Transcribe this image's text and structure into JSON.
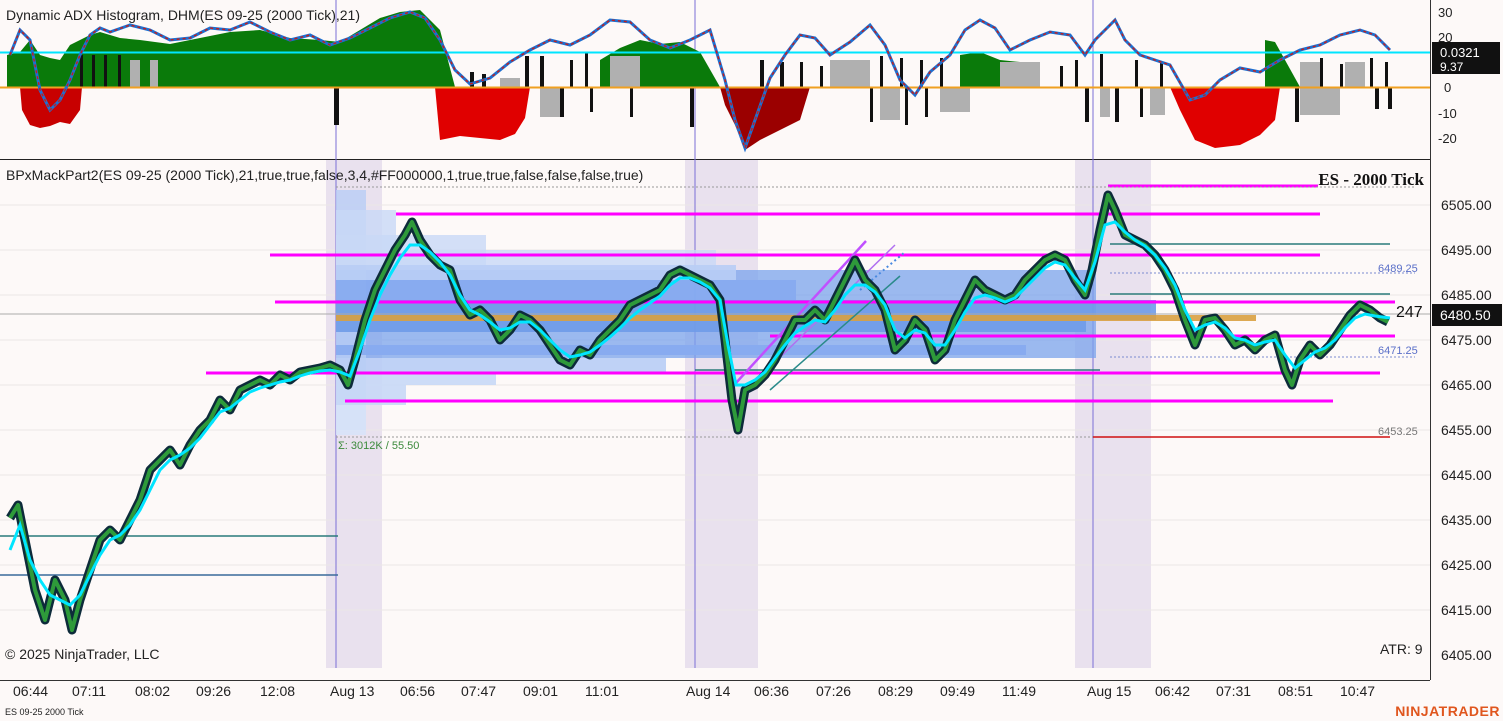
{
  "adx_panel": {
    "title": "Dynamic ADX Histogram, DHM(ES 09-25 (2000 Tick),21)",
    "axis_ticks": [
      "30",
      "20",
      "10",
      "0",
      "-10",
      "-20"
    ],
    "value_badge": "0.0321",
    "sub_value": "9.37"
  },
  "price_panel": {
    "title": "BPxMackPart2(ES 09-25 (2000 Tick),21,true,true,false,3,4,#FF000000,1,true,true,false,false,false,true)",
    "heading": "ES - 2000 Tick",
    "axis_ticks": [
      "6505.00",
      "6495.00",
      "6485.00",
      "6475.00",
      "6465.00",
      "6455.00",
      "6445.00",
      "6435.00",
      "6425.00",
      "6415.00",
      "6405.00"
    ],
    "last_price": "6480.50",
    "bar_counter": "247",
    "level_labels": [
      "6489.25",
      "6471.25",
      "6453.25"
    ],
    "volume_profile_label": "Σ: 3012K / 55.50",
    "copyright": "© 2025 NinjaTrader, LLC",
    "atr": "ATR: 9"
  },
  "time_axis": [
    "06:44",
    "07:11",
    "08:02",
    "09:26",
    "12:08",
    "Aug 13",
    "06:56",
    "07:47",
    "09:01",
    "11:01",
    "Aug 14",
    "06:36",
    "07:26",
    "08:29",
    "09:49",
    "11:49",
    "Aug 15",
    "06:42",
    "07:31",
    "08:51",
    "10:47"
  ],
  "footer": {
    "instrument": "ES 09-25 2000 Tick",
    "brand": "NINJATRADER"
  },
  "colors": {
    "magenta_level": "#ff00ff",
    "cyan_ma": "#00e5ff",
    "bull_hist": "#0a7a0a",
    "bear_hist": "#e00000",
    "session_shade": "#e9e1ee",
    "profile": "#6f9be8"
  }
}
